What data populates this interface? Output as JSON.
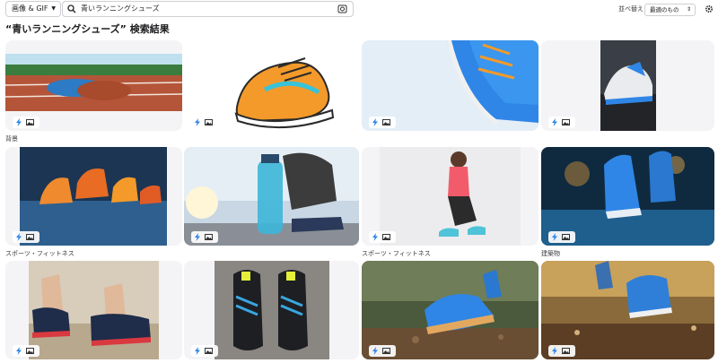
{
  "toolbar": {
    "type_select": "画像 & GIF",
    "search_query": "青いランニングシューズ",
    "sort_label": "並べ替え",
    "sort_value": "最適のもの"
  },
  "results_title": "“青いランニングシューズ” 検索結果",
  "captions": {
    "row1_col1": "背景",
    "row2_col1": "スポーツ・フィットネス",
    "row2_col3": "スポーツ・フィットネス",
    "row2_col4": "建築物"
  },
  "icons": [
    "search-icon",
    "camera-icon",
    "settings-icon",
    "bolt-icon",
    "image-icon"
  ],
  "colors": {
    "accent_blue": "#2f86e6",
    "orange": "#f39a2a",
    "card_bg": "#f4f4f6"
  }
}
